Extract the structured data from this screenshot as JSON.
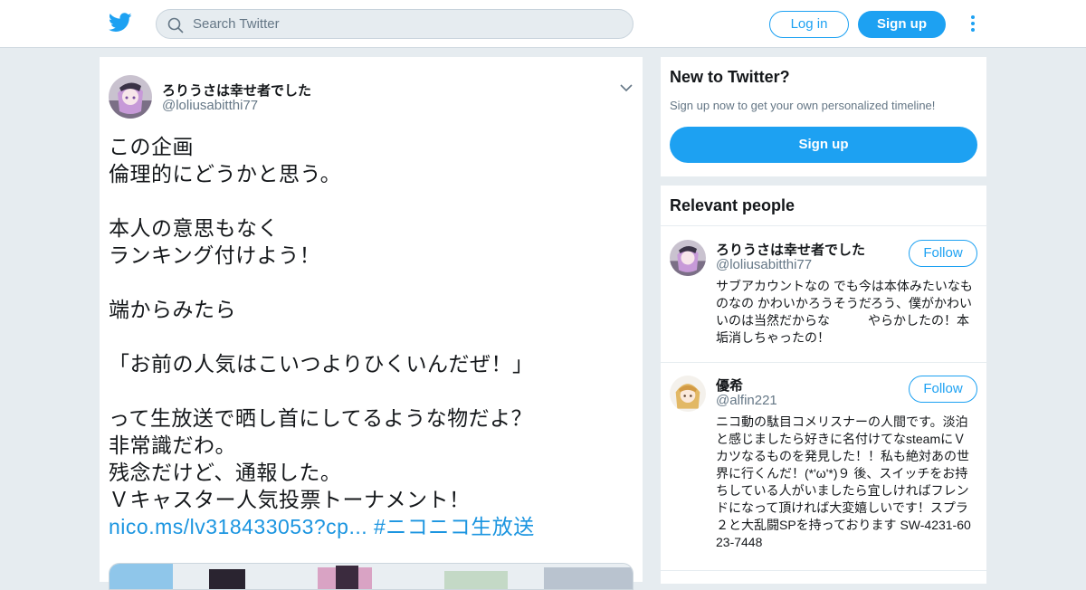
{
  "header": {
    "logo_icon": "twitter-bird-icon",
    "search_placeholder": "Search Twitter",
    "login_label": "Log in",
    "signup_label": "Sign up",
    "more_icon": "vertical-dots-icon",
    "brand_color": "#1da1f2"
  },
  "tweet": {
    "display_name": "ろりうさは幸せ者でした",
    "handle": "@loliusabitthi77",
    "lines": [
      "この企画",
      "倫理的にどうかと思う。",
      "",
      "本人の意思もなく",
      "ランキング付けよう！",
      "",
      "端からみたら",
      "",
      "「お前の人気はこいつよりひくいんだぜ！」",
      "",
      "って生放送で晒し首にしてるような物だよ？",
      "非常識だわ。",
      "残念だけど、通報した。",
      "Ｖキャスター人気投票トーナメント！"
    ],
    "link": "nico.ms/lv318433053?cp...",
    "hashtag": "#ニコニコ生放送"
  },
  "new_to_twitter": {
    "title": "New to Twitter?",
    "subtitle": "Sign up now to get your own personalized timeline!",
    "signup_label": "Sign up"
  },
  "relevant_people": {
    "title": "Relevant people",
    "people": [
      {
        "name": "ろりうさは幸せ者でした",
        "handle": "@loliusabitthi77",
        "follow_label": "Follow",
        "bio": "サブアカウントなの でも今は本体みたいなものなの かわいかろうそうだろう、僕がかわいいのは当然だからな　　　やらかしたの！本垢消しちゃったの！"
      },
      {
        "name": "優希",
        "handle": "@alfin221",
        "follow_label": "Follow",
        "bio": "ニコ動の駄目コメリスナーの人間です。淡泊と感じましたら好きに名付けてなsteamにＶカツなるものを発見した！！私も絶対あの世界に行くんだ！(*'ω'*)９ 後、スイッチをお持ちしている人がいましたら宜しければフレンドになって頂ければ大変嬉しいです！スプラ２と大乱闘SPを持っております SW-4231-6023-7448"
      }
    ]
  }
}
